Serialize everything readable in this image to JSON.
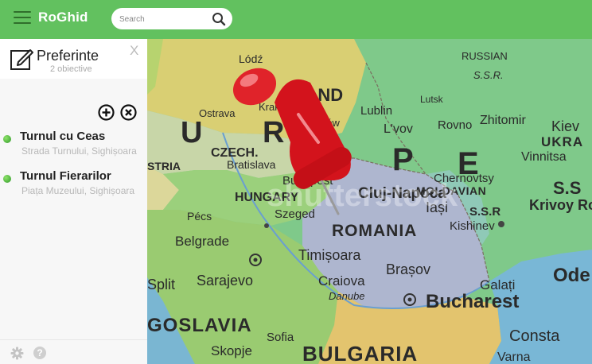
{
  "header": {
    "brand": "RoGhid",
    "search_placeholder": "Search"
  },
  "sidebar": {
    "title": "Preferinte",
    "subtitle": "2 obiective",
    "close_label": "X",
    "places": [
      {
        "name": "Turnul cu Ceas",
        "address": "Strada Turnului, Sighișoara"
      },
      {
        "name": "Turnul Fierarilor",
        "address": "Piața Muzeului, Sighișoara"
      }
    ],
    "help_label": "?"
  },
  "map": {
    "labels": {
      "russian": "RUSSIAN",
      "ssr_top": "S.S.R.",
      "land": "LAND",
      "lodz": "Lódź",
      "lublin": "Lublin",
      "lutsk": "Lutsk",
      "lvov": "L'vov",
      "rovno": "Rovno",
      "zhitomir": "Zhitomir",
      "kiev": "Kiev",
      "ukra": "UKRA",
      "vinnitsa": "Vinnitsa",
      "ostrava": "Ostrava",
      "czech": "CZECH.",
      "krakow": "Kraków",
      "tarnow": "Tarnów",
      "u": "U",
      "r": "R",
      "p": "P",
      "e": "E",
      "ss": "S.S",
      "chernovtsy": "Chernovtsy",
      "moldavian": "MOLDAVIAN",
      "krivoy_rog": "Krivoy Rog",
      "bratislava": "Bratislava",
      "budapest": "Budapest",
      "hungary": "HUNGARY",
      "cluj_napoca": "Cluj-Napoca",
      "iasi": "Iași",
      "ssr": "S.S.R",
      "kishinev": "Kishinev",
      "stria": "STRIA",
      "pecs": "Pécs",
      "szeged": "Szeged",
      "romania": "ROMANIA",
      "belgrade": "Belgrade",
      "timisoara": "Timișoara",
      "brasov": "Brașov",
      "galati": "Galați",
      "odessa": "Ode",
      "split": "Split",
      "sarajevo": "Sarajevo",
      "craiova": "Craiova",
      "danube": "Danube",
      "bucharest": "Bucharest",
      "goslavia": "GOSLAVIA",
      "bulgaria": "BULGARIA",
      "skopje": "Skopje",
      "consta": "Consta",
      "varna": "Varna",
      "sofia": "Sofia",
      "watermark": "shutterstock"
    }
  },
  "colors": {
    "header": "#62c15f",
    "pin": "#d3131c",
    "romania": "#aeb6cf",
    "ukraine": "#7fc98a",
    "yugoslavia": "#9acb71",
    "bulgaria": "#e3c46e",
    "hungary": "#9bd07c",
    "poland": "#d9cf73"
  }
}
